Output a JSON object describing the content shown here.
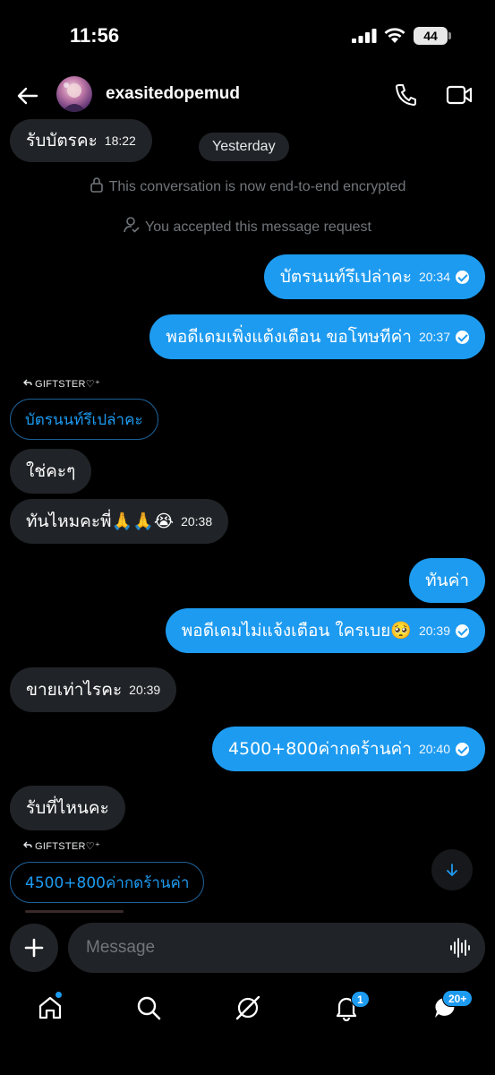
{
  "status_bar": {
    "time": "11:56",
    "battery": "44"
  },
  "header": {
    "username": "exasitedopemud"
  },
  "system": {
    "date_divider": "Yesterday",
    "encrypted": "This conversation is now end-to-end encrypted",
    "accepted": "You accepted this message request"
  },
  "messages": [
    {
      "dir": "in",
      "text": "รับบัตรคะ",
      "time": "18:22"
    },
    {
      "dir": "out",
      "text": "บัตรนนท์รึเปล่าคะ",
      "time": "20:34"
    },
    {
      "dir": "out",
      "text": "พอดีเดมเพิ่งแต้งเตือน ขอโทษทีค่า",
      "time": "20:37"
    },
    {
      "dir": "reply",
      "label": "GIFTSTER♡⁺",
      "quote": "บัตรนนท์รึเปล่าคะ"
    },
    {
      "dir": "in",
      "text": "ใช่คะๆ",
      "time": ""
    },
    {
      "dir": "in",
      "text": "ทันไหมคะพี่🙏🙏😭",
      "time": "20:38"
    },
    {
      "dir": "out",
      "text": "ทันค่า",
      "time": ""
    },
    {
      "dir": "out",
      "text": "พอดีเดมไม่แจ้งเตือน ใครเบย🥺",
      "time": "20:39"
    },
    {
      "dir": "in",
      "text": "ขายเท่าไรคะ",
      "time": "20:39"
    },
    {
      "dir": "out",
      "text": "4500+800ค่ากดร้านค่า",
      "time": "20:40"
    },
    {
      "dir": "in",
      "text": "รับที่ไหนคะ",
      "time": ""
    },
    {
      "dir": "reply",
      "label": "GIFTSTER♡⁺",
      "quote": "4500+800ค่ากดร้านค่า"
    }
  ],
  "composer": {
    "placeholder": "Message"
  },
  "tabbar": {
    "notifications_badge": "1",
    "messages_badge": "20+"
  },
  "colors": {
    "accent": "#1d9bf0",
    "incoming_bubble": "#202327",
    "background": "#000000",
    "muted": "#71767b"
  },
  "icons": [
    "back-arrow-icon",
    "phone-icon",
    "video-camera-icon",
    "lock-icon",
    "person-check-icon",
    "reply-arrow-icon",
    "arrow-down-icon",
    "plus-icon",
    "voice-wave-icon",
    "home-icon",
    "search-icon",
    "grok-icon",
    "bell-icon",
    "mail-bubble-icon"
  ]
}
